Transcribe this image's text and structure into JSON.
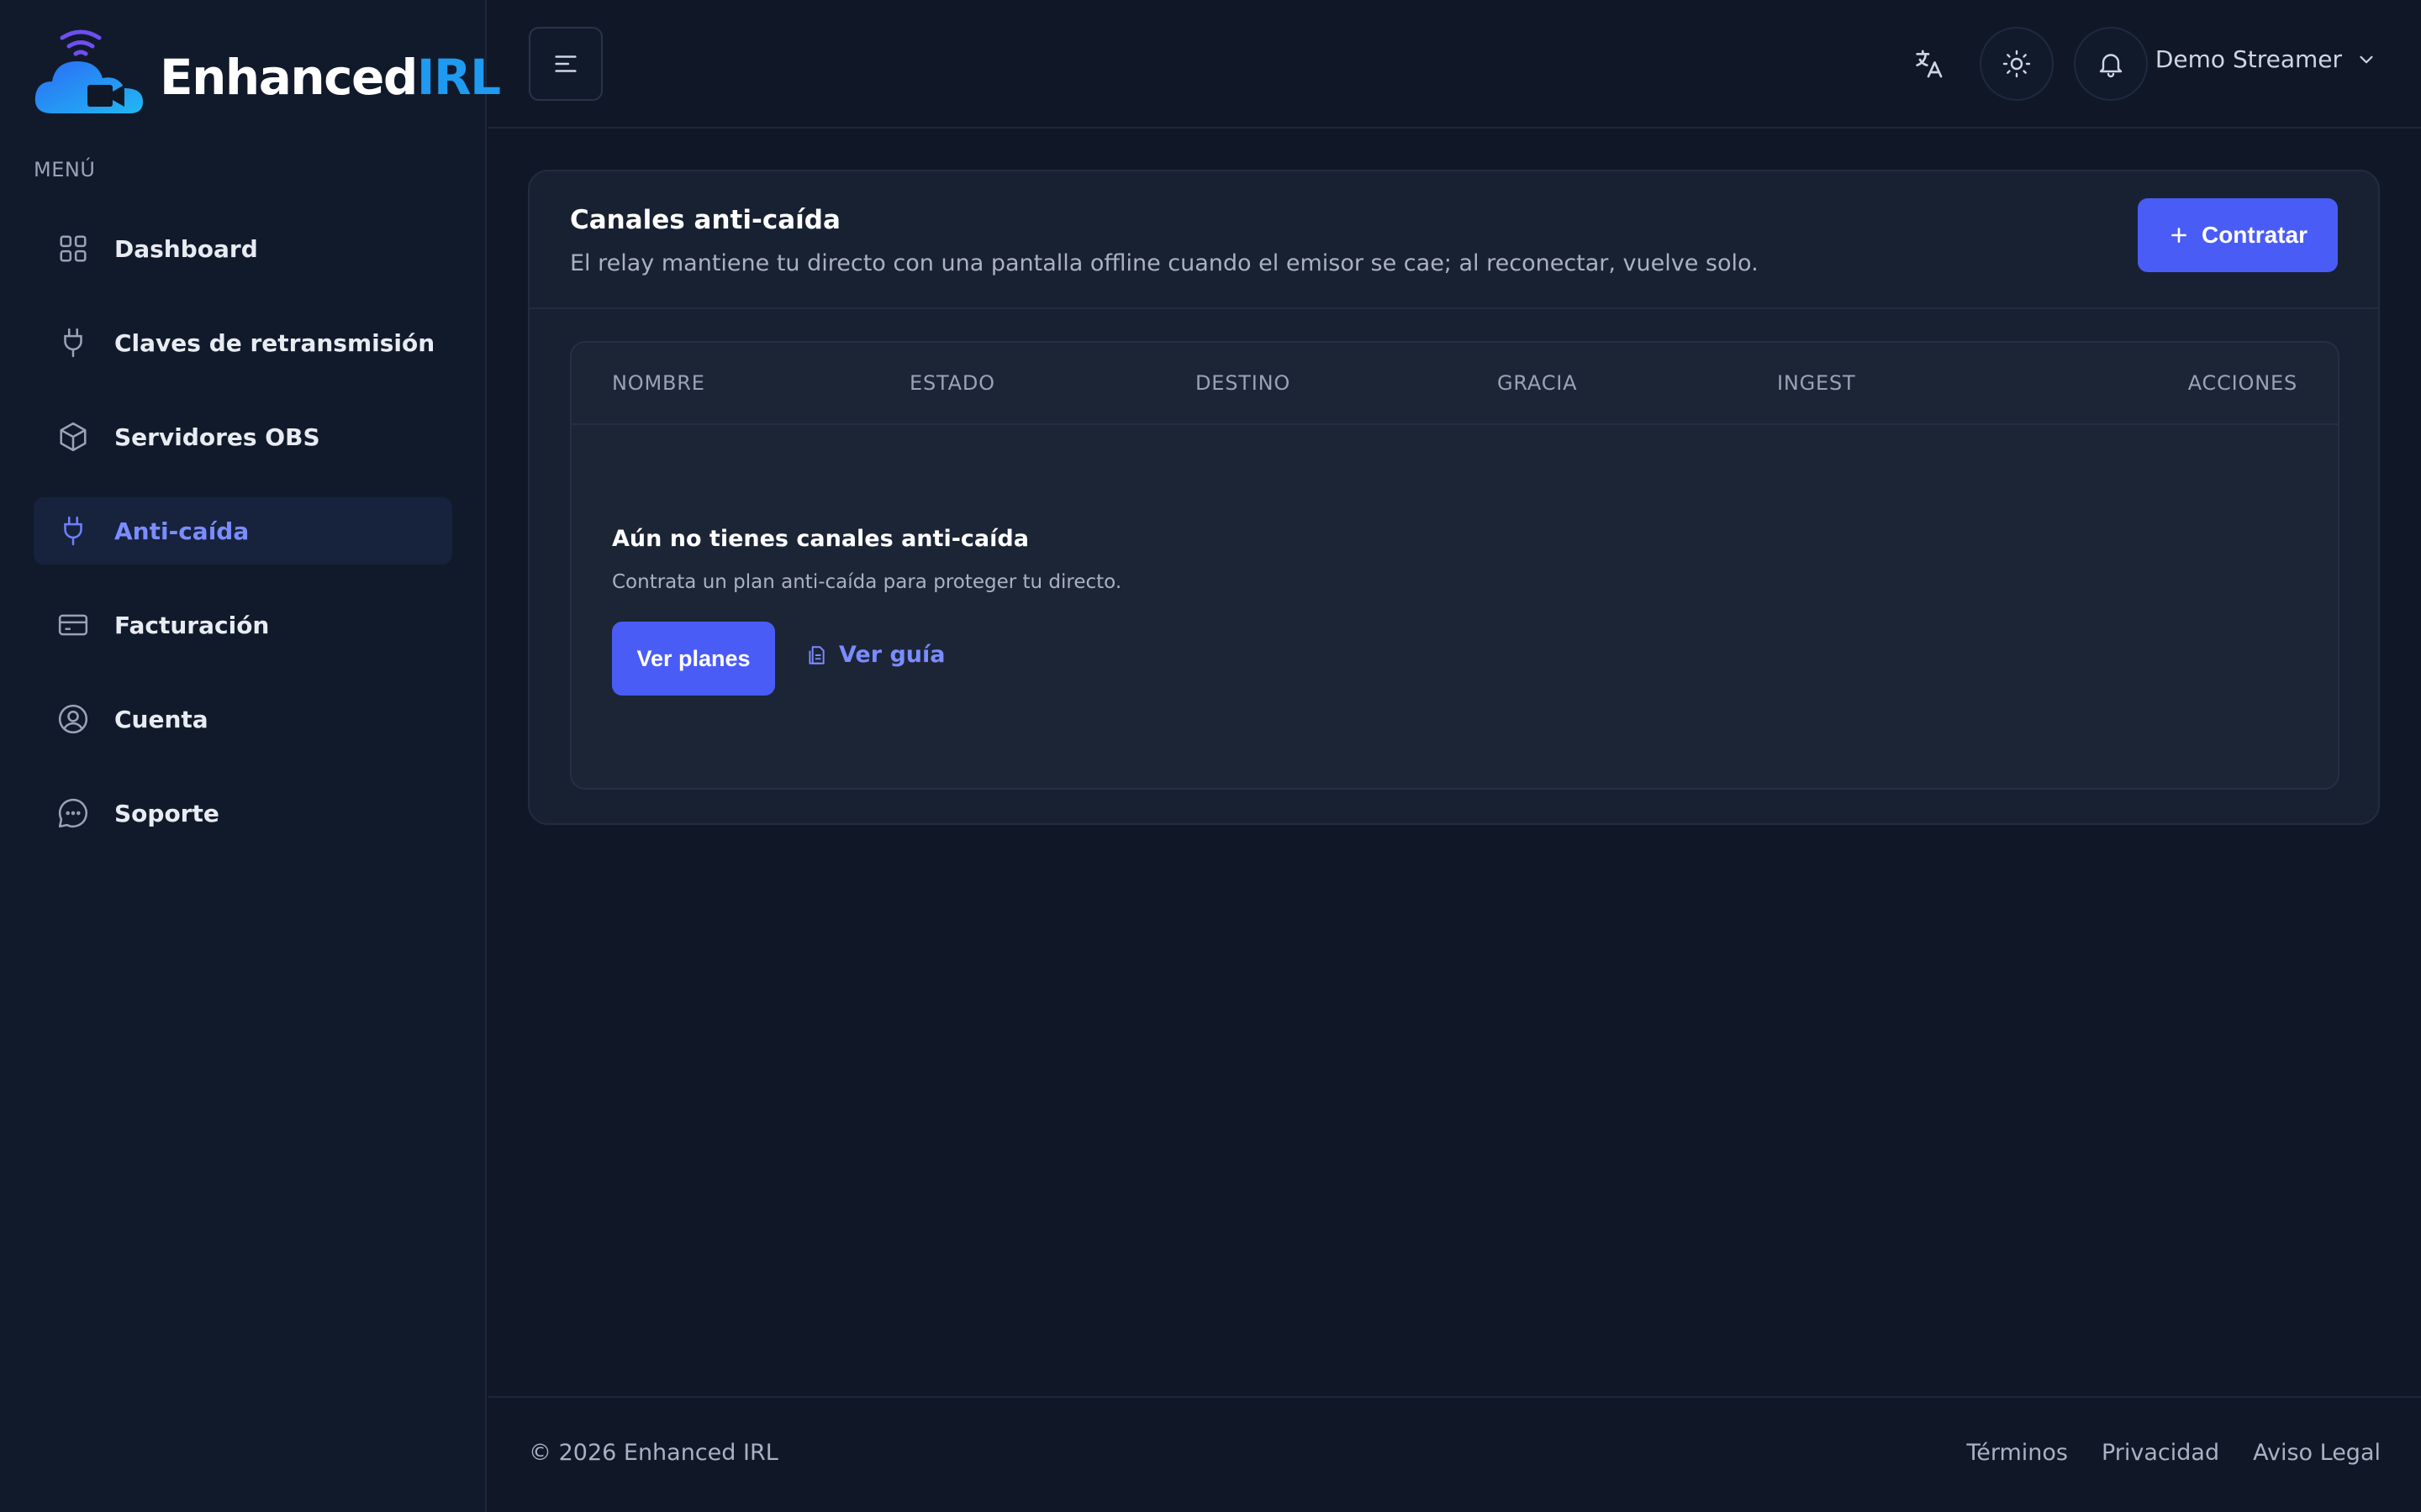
{
  "brand": {
    "name_part1": "Enhanced",
    "name_part2": "IRL"
  },
  "sidebar": {
    "menu_label": "MENÚ",
    "items": [
      {
        "label": "Dashboard",
        "icon": "grid-icon",
        "active": false
      },
      {
        "label": "Claves de retransmisión",
        "icon": "plug-icon",
        "active": false
      },
      {
        "label": "Servidores OBS",
        "icon": "cube-icon",
        "active": false
      },
      {
        "label": "Anti-caída",
        "icon": "plug-icon",
        "active": true
      },
      {
        "label": "Facturación",
        "icon": "credit-card-icon",
        "active": false
      },
      {
        "label": "Cuenta",
        "icon": "user-circle-icon",
        "active": false
      },
      {
        "label": "Soporte",
        "icon": "chat-icon",
        "active": false
      }
    ]
  },
  "header": {
    "user_name": "Demo Streamer"
  },
  "card": {
    "title": "Canales anti-caída",
    "subtitle": "El relay mantiene tu directo con una pantalla offline cuando el emisor se cae; al reconectar, vuelve solo.",
    "action_label": "Contratar",
    "table": {
      "columns": [
        "NOMBRE",
        "ESTADO",
        "DESTINO",
        "GRACIA",
        "INGEST",
        "ACCIONES"
      ]
    },
    "empty": {
      "title": "Aún no tienes canales anti-caída",
      "subtitle": "Contrata un plan anti-caída para proteger tu directo.",
      "plans_label": "Ver planes",
      "guide_label": "Ver guía"
    }
  },
  "footer": {
    "copyright": "© 2026 Enhanced IRL",
    "links": [
      "Términos",
      "Privacidad",
      "Aviso Legal"
    ]
  },
  "colors": {
    "background": "#101828",
    "sidebar": "#111a2b",
    "accent": "#4a5cf6",
    "active_text": "#7b8cff",
    "brand_blue": "#1e9bf0"
  }
}
